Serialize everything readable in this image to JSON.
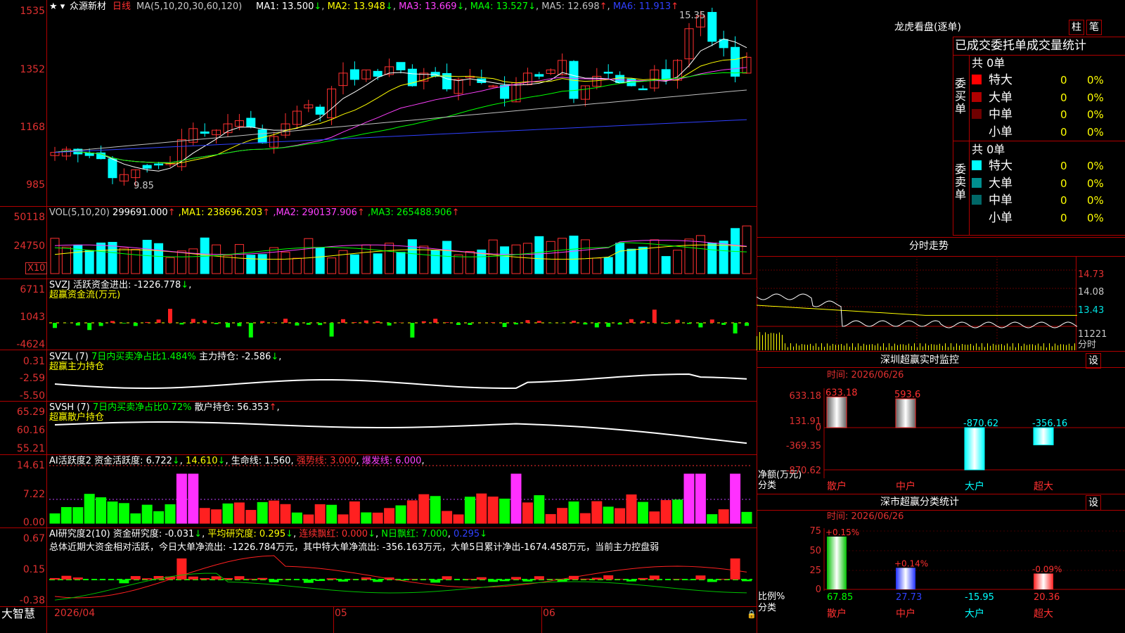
{
  "app": {
    "logo": "大智慧"
  },
  "kline": {
    "stock": "众源新材",
    "period": "日线",
    "ma_label": "MA(5,10,20,30,60,120)",
    "ma": [
      {
        "name": "MA1",
        "value": "13.500",
        "arrow": "↓",
        "color": "#ffffff"
      },
      {
        "name": "MA2",
        "value": "13.948",
        "arrow": "↓",
        "color": "#ffff00"
      },
      {
        "name": "MA3",
        "value": "13.669",
        "arrow": "↓",
        "color": "#ff40ff"
      },
      {
        "name": "MA4",
        "value": "13.527",
        "arrow": "↓",
        "color": "#00ff00"
      },
      {
        "name": "MA5",
        "value": "12.698",
        "arrow": "↑",
        "color": "#c0c0c0"
      },
      {
        "name": "MA6",
        "value": "11.913",
        "arrow": "↑",
        "color": "#3040ff"
      }
    ],
    "axis": [
      "1535",
      "1352",
      "1168",
      "985"
    ],
    "high_label": "15.35",
    "low_label": "9.85"
  },
  "vol": {
    "label": "VOL(5,10,20)",
    "value": "299691.000",
    "arrow": "↑",
    "ma": [
      {
        "name": "MA1",
        "value": "238696.203",
        "arrow": "↑"
      },
      {
        "name": "MA2",
        "value": "290137.906",
        "arrow": "↑"
      },
      {
        "name": "MA3",
        "value": "265488.906",
        "arrow": "↑"
      }
    ],
    "axis": [
      "50118",
      "24750"
    ],
    "unit": "X10"
  },
  "svzj": {
    "label": "SVZJ",
    "title": "活跃资金进出:",
    "value": "-1226.778",
    "arrow": "↓",
    "sub": "超赢资金流(万元)",
    "axis": [
      "6711",
      "1043",
      "-4624"
    ]
  },
  "svzl": {
    "label": "SVZL (7)",
    "ratio": "7日内买卖净占比1.484%",
    "hold": "主力持仓: -2.586",
    "arrow": "↓",
    "sub": "超赢主力持仓",
    "axis": [
      "0.31",
      "-2.59",
      "-5.50"
    ]
  },
  "svsh": {
    "label": "SVSH (7)",
    "ratio": "7日内买卖净占比0.72%",
    "hold": "散户持仓: 56.353",
    "arrow": "↑",
    "sub": "超赢散户持仓",
    "axis": [
      "65.29",
      "60.16",
      "55.21"
    ]
  },
  "ai1": {
    "label": "AI活跃度2",
    "t1": "资金活跃度: 6.722",
    "t2": "14.610",
    "t3": "生命线: 1.560",
    "t4": "强势线: 3.000",
    "t5": "爆发线: 6.000",
    "axis": [
      "14.61",
      "7.22",
      "0.00"
    ]
  },
  "ai2": {
    "label": "AI研究度2(10)",
    "t1": "资金研究度: -0.031",
    "t2": "平均研究度: 0.295",
    "t3": "连续飘红: 0.000",
    "t4": "N日飘红: 7.000",
    "t5": "0.295",
    "desc": "总体近期大资金相对活跃，今日大单净流出: -1226.784万元，其中特大单净流出: -356.163万元，大单5日累计净出-1674.458万元，当前主力控盘弱",
    "axis": [
      "0.67",
      "0.15",
      "-0.38"
    ]
  },
  "xaxis": {
    "labels": [
      "2026/04",
      "05",
      "06"
    ]
  },
  "lhkp": {
    "title": "龙虎看盘(逐单)",
    "btn1": "柱",
    "btn2": "笔",
    "tabs": [
      "已成交",
      "委托单",
      "成交量统计"
    ],
    "buy": {
      "side": "委买单",
      "total": "共 0单",
      "rows": [
        {
          "label": "特大",
          "color": "#ff0000",
          "val": "0",
          "pct": "0%"
        },
        {
          "label": "大单",
          "color": "#b00000",
          "val": "0",
          "pct": "0%"
        },
        {
          "label": "中单",
          "color": "#700000",
          "val": "0",
          "pct": "0%"
        },
        {
          "label": "小单",
          "color": "#000000",
          "val": "0",
          "pct": "0%"
        }
      ]
    },
    "sell": {
      "side": "委卖单",
      "total": "共 0单",
      "rows": [
        {
          "label": "特大",
          "color": "#00ffff",
          "val": "0",
          "pct": "0%"
        },
        {
          "label": "大单",
          "color": "#009090",
          "val": "0",
          "pct": "0%"
        },
        {
          "label": "中单",
          "color": "#006868",
          "val": "0",
          "pct": "0%"
        },
        {
          "label": "小单",
          "color": "#000000",
          "val": "0",
          "pct": "0%"
        }
      ]
    }
  },
  "fszs": {
    "title": "分时走势",
    "axis": [
      "14.73",
      "14.08",
      "13.43"
    ],
    "vol_axis": "11221",
    "unit": "分时"
  },
  "szcy": {
    "title": "深圳超赢实时监控",
    "btn": "设",
    "time": "时间: 2026/06/26",
    "axis": [
      "633.18",
      "131.91",
      "0",
      "-369.35",
      "-870.62"
    ],
    "unit": "净额(万元)",
    "cat_label": "分类",
    "bars": [
      {
        "name": "散户",
        "value": "633.18"
      },
      {
        "name": "中户",
        "value": "593.6"
      },
      {
        "name": "大户",
        "value": "-870.62"
      },
      {
        "name": "超大",
        "value": "-356.16"
      }
    ]
  },
  "sscy": {
    "title": "深市超赢分类统计",
    "btn": "设",
    "time": "时间: 2026/06/26",
    "axis": [
      "75",
      "50",
      "25",
      "0"
    ],
    "unit": "比例%",
    "cat_label": "分类",
    "bars": [
      {
        "name": "散户",
        "pct": "67.85",
        "change": "+0.15%"
      },
      {
        "name": "中户",
        "pct": "27.73",
        "change": "+0.14%"
      },
      {
        "name": "大户",
        "pct": "-15.95",
        "change": ""
      },
      {
        "name": "超大",
        "pct": "20.36",
        "change": "-0.09%"
      }
    ]
  }
}
